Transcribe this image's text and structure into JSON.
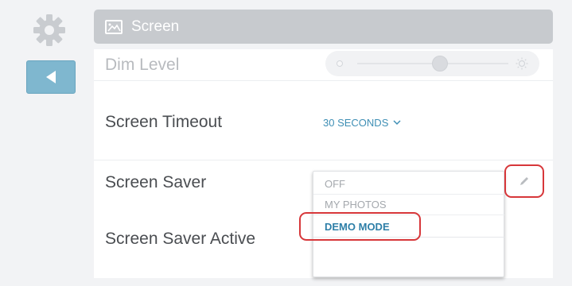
{
  "header": {
    "title": "Screen",
    "icon": "screen-image-icon"
  },
  "nav": {
    "settings_icon": "gear-icon",
    "back_icon": "back-arrow-icon"
  },
  "settings": {
    "dim_level": {
      "label": "Dim Level",
      "value_fraction": 0.5
    },
    "timeout": {
      "label": "Screen Timeout",
      "value": "30 SECONDS"
    },
    "saver": {
      "label": "Screen Saver"
    },
    "saver_active": {
      "label": "Screen Saver Active"
    }
  },
  "dropdown": {
    "options": [
      "OFF",
      "MY PHOTOS",
      "DEMO MODE"
    ],
    "selected": "DEMO MODE"
  },
  "colors": {
    "accent": "#3f8fb5",
    "back_button": "#7fb7cf",
    "header_bar": "#c7cace",
    "highlight": "#d7373a"
  }
}
